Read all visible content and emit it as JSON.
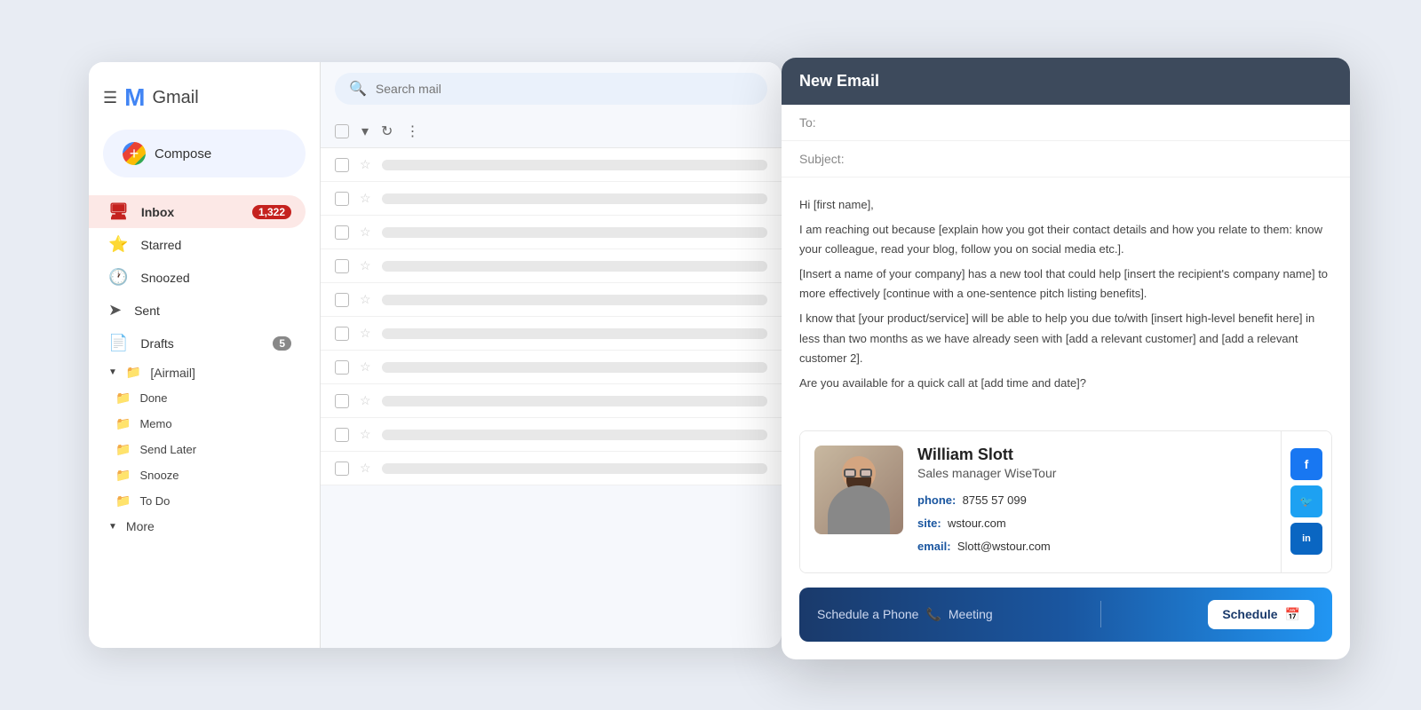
{
  "gmail": {
    "logo_text": "Gmail",
    "compose_label": "Compose",
    "search_placeholder": "Search mail",
    "nav_items": [
      {
        "id": "inbox",
        "label": "Inbox",
        "icon": "📥",
        "badge": "1,322",
        "active": true
      },
      {
        "id": "starred",
        "label": "Starred",
        "icon": "⭐",
        "badge": null,
        "active": false
      },
      {
        "id": "snoozed",
        "label": "Snoozed",
        "icon": "🕐",
        "badge": null,
        "active": false
      },
      {
        "id": "sent",
        "label": "Sent",
        "icon": "➤",
        "badge": null,
        "active": false
      },
      {
        "id": "drafts",
        "label": "Drafts",
        "icon": "📄",
        "badge": "5",
        "active": false
      }
    ],
    "airmail_label": "[Airmail]",
    "airmail_folders": [
      "Done",
      "Memo",
      "Send Later",
      "Snooze",
      "To Do"
    ],
    "more_label": "More",
    "mail_rows_count": 10
  },
  "new_email": {
    "title": "New Email",
    "to_label": "To:",
    "subject_label": "Subject:",
    "body": {
      "greeting": "Hi [first name],",
      "line1": "I am reaching out because [explain how you got their contact details and how you relate to them: know your colleague, read your blog, follow you on social media etc.].",
      "line2": "[Insert a name of your company] has a new tool that could help [insert the recipient's company name] to more effectively [continue with a one-sentence pitch listing benefits].",
      "line3": "I know that [your product/service] will be able to help you due to/with [insert high-level benefit here] in less than two months as we have already seen with [add a relevant customer] and [add a relevant customer 2].",
      "line4": "Are you available for a quick call at [add time and date]?"
    },
    "signature": {
      "name": "William Slott",
      "title": "Sales manager WiseTour",
      "phone_label": "phone:",
      "phone": "8755 57 099",
      "site_label": "site:",
      "site": "wstour.com",
      "email_label": "email:",
      "email": "Slott@wstour.com",
      "social": [
        {
          "id": "facebook",
          "letter": "f",
          "class": "fb"
        },
        {
          "id": "twitter",
          "letter": "t",
          "class": "tw"
        },
        {
          "id": "linkedin",
          "letter": "in",
          "class": "li"
        }
      ]
    },
    "schedule": {
      "left_text": "Schedule a Phone",
      "phone_icon": "📞",
      "meeting_text": "Meeting",
      "right_text": "Schedule",
      "calendar_icon": "📅"
    }
  }
}
